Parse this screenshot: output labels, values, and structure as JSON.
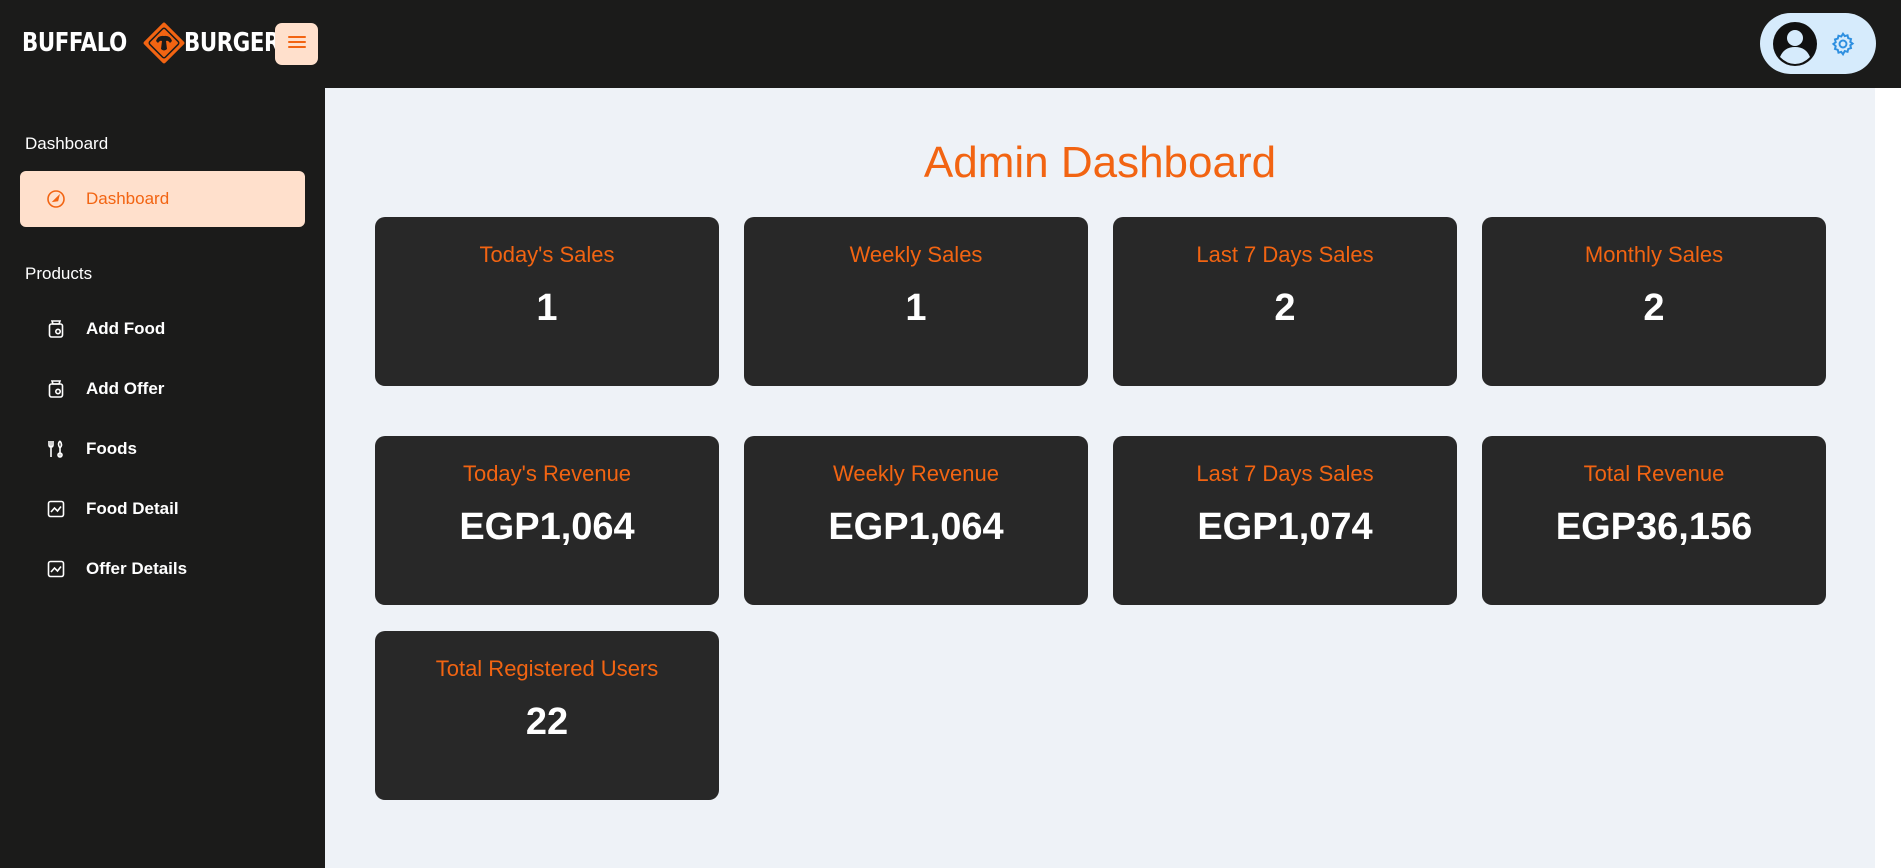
{
  "header": {
    "logo": {
      "word1": "BUFFALO",
      "word2": "BURGER",
      "trademark": "™"
    },
    "menu_icon": "hamburger-menu-icon",
    "user_icon": "user-circle-icon",
    "settings_icon": "gear-icon"
  },
  "sidebar": {
    "sections": [
      {
        "title": "Dashboard",
        "items": [
          {
            "label": "Dashboard",
            "icon": "gauge-icon",
            "active": true
          }
        ]
      },
      {
        "title": "Products",
        "items": [
          {
            "label": "Add Food",
            "icon": "food-bag-icon"
          },
          {
            "label": "Add Offer",
            "icon": "food-bag-icon"
          },
          {
            "label": "Foods",
            "icon": "utensils-icon"
          },
          {
            "label": "Food Detail",
            "icon": "chart-icon"
          },
          {
            "label": "Offer Details",
            "icon": "chart-icon"
          }
        ]
      }
    ]
  },
  "main": {
    "title": "Admin Dashboard",
    "cards": [
      {
        "label": "Today's Sales",
        "value": "1"
      },
      {
        "label": "Weekly Sales",
        "value": "1"
      },
      {
        "label": "Last 7 Days Sales",
        "value": "2"
      },
      {
        "label": "Monthly Sales",
        "value": "2"
      },
      {
        "label": "Today's Revenue",
        "value": "EGP1,064"
      },
      {
        "label": "Weekly Revenue",
        "value": "EGP1,064"
      },
      {
        "label": "Last 7 Days Sales",
        "value": "EGP1,074"
      },
      {
        "label": "Total Revenue",
        "value": "EGP36,156"
      },
      {
        "label": "Total Registered Users",
        "value": "22"
      }
    ]
  },
  "colors": {
    "accent": "#f26412",
    "sidebar_bg": "#1b1b1a",
    "card_bg": "#282828",
    "active_bg": "#ffe0cc",
    "main_bg": "#eef2f7",
    "user_pill_bg": "#d6ebfc",
    "gear_color": "#2e8fe0"
  }
}
